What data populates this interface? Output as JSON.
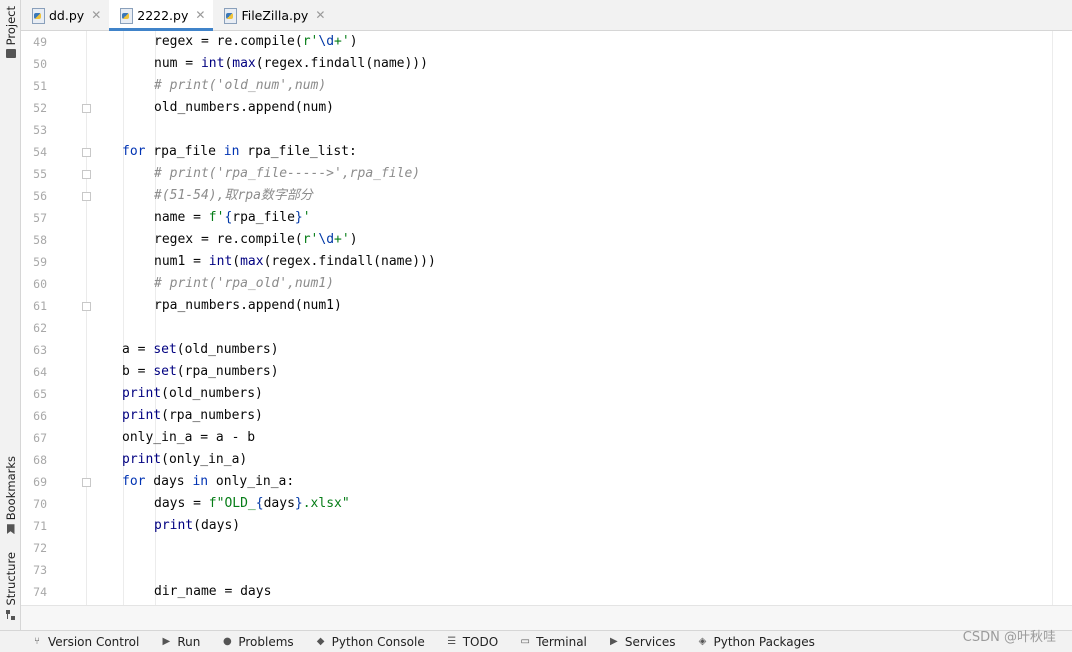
{
  "tool_windows": {
    "project": "Project",
    "bookmarks": "Bookmarks",
    "structure": "Structure"
  },
  "tabs": [
    {
      "label": "dd.py",
      "close": "✕",
      "active": false
    },
    {
      "label": "2222.py",
      "close": "✕",
      "active": true
    },
    {
      "label": "FileZilla.py",
      "close": "✕",
      "active": false
    }
  ],
  "editor": {
    "lines": [
      {
        "num": "49",
        "indent": 2,
        "fold": false,
        "code": "regex = re.compile(r'\\d+')"
      },
      {
        "num": "50",
        "indent": 2,
        "fold": false,
        "code": "num = int(max(regex.findall(name)))"
      },
      {
        "num": "51",
        "indent": 2,
        "fold": false,
        "code": "# print('old_num',num)"
      },
      {
        "num": "52",
        "indent": 2,
        "fold": true,
        "code": "old_numbers.append(num)"
      },
      {
        "num": "53",
        "indent": 0,
        "fold": false,
        "code": ""
      },
      {
        "num": "54",
        "indent": 1,
        "fold": true,
        "code": "for rpa_file in rpa_file_list:"
      },
      {
        "num": "55",
        "indent": 2,
        "fold": true,
        "code": "# print('rpa_file----->',rpa_file)"
      },
      {
        "num": "56",
        "indent": 2,
        "fold": true,
        "code": "#(51-54),取rpa数字部分"
      },
      {
        "num": "57",
        "indent": 2,
        "fold": false,
        "code": "name = f'{rpa_file}'"
      },
      {
        "num": "58",
        "indent": 2,
        "fold": false,
        "code": "regex = re.compile(r'\\d+')"
      },
      {
        "num": "59",
        "indent": 2,
        "fold": false,
        "code": "num1 = int(max(regex.findall(name)))"
      },
      {
        "num": "60",
        "indent": 2,
        "fold": false,
        "code": "# print('rpa_old',num1)"
      },
      {
        "num": "61",
        "indent": 2,
        "fold": true,
        "code": "rpa_numbers.append(num1)"
      },
      {
        "num": "62",
        "indent": 0,
        "fold": false,
        "code": ""
      },
      {
        "num": "63",
        "indent": 1,
        "fold": false,
        "code": "a = set(old_numbers)"
      },
      {
        "num": "64",
        "indent": 1,
        "fold": false,
        "code": "b = set(rpa_numbers)"
      },
      {
        "num": "65",
        "indent": 1,
        "fold": false,
        "code": "print(old_numbers)"
      },
      {
        "num": "66",
        "indent": 1,
        "fold": false,
        "code": "print(rpa_numbers)"
      },
      {
        "num": "67",
        "indent": 1,
        "fold": false,
        "code": "only_in_a = a - b"
      },
      {
        "num": "68",
        "indent": 1,
        "fold": false,
        "code": "print(only_in_a)"
      },
      {
        "num": "69",
        "indent": 1,
        "fold": true,
        "code": "for days in only_in_a:"
      },
      {
        "num": "70",
        "indent": 2,
        "fold": false,
        "code": "days = f\"OLD_{days}.xlsx\""
      },
      {
        "num": "71",
        "indent": 2,
        "fold": false,
        "code": "print(days)"
      },
      {
        "num": "72",
        "indent": 0,
        "fold": false,
        "code": ""
      },
      {
        "num": "73",
        "indent": 0,
        "fold": false,
        "code": ""
      },
      {
        "num": "74",
        "indent": 2,
        "fold": false,
        "code": "dir_name = days"
      }
    ]
  },
  "bottom_bar": {
    "items": [
      {
        "label": "Version Control",
        "icon": "branch-icon"
      },
      {
        "label": "Run",
        "icon": "run-icon"
      },
      {
        "label": "Problems",
        "icon": "problems-icon"
      },
      {
        "label": "Python Console",
        "icon": "python-console-icon"
      },
      {
        "label": "TODO",
        "icon": "todo-icon"
      },
      {
        "label": "Terminal",
        "icon": "terminal-icon"
      },
      {
        "label": "Services",
        "icon": "services-icon"
      },
      {
        "label": "Python Packages",
        "icon": "packages-icon"
      }
    ],
    "watermark": "CSDN @叶秋哇"
  }
}
